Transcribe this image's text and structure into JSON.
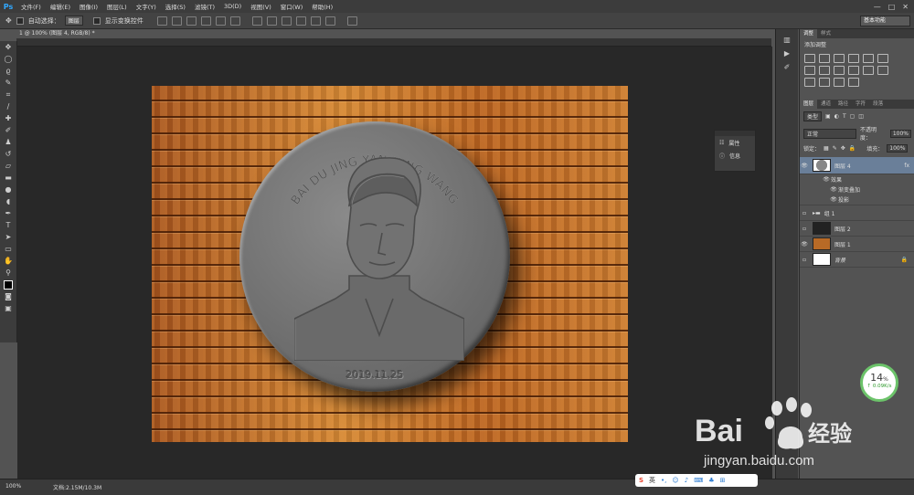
{
  "app": {
    "logo": "Ps"
  },
  "menu": [
    "文件(F)",
    "编辑(E)",
    "图像(I)",
    "图层(L)",
    "文字(Y)",
    "选择(S)",
    "滤镜(T)",
    "3D(D)",
    "视图(V)",
    "窗口(W)",
    "帮助(H)"
  ],
  "options": {
    "auto_select": "自动选择：",
    "auto_select_target": "图层",
    "show_transform": "显示变换控件",
    "workspace": "基本功能"
  },
  "doc_tab": "1 @ 100% (图层 4, RGB/8) *",
  "coin": {
    "top_text": "BAI DU JING YAN XING WANG",
    "date": "2019.11.25"
  },
  "mini_panel": {
    "properties": "属性",
    "info": "信息"
  },
  "adjustments": {
    "tabs": [
      "调整",
      "样式"
    ],
    "title": "添加调整"
  },
  "layers_panel": {
    "tabs": [
      "图层",
      "通道",
      "路径",
      "字符",
      "段落"
    ],
    "filter": "类型",
    "blend_mode": "正常",
    "opacity_label": "不透明度：",
    "opacity": "100%",
    "lock_label": "锁定：",
    "fill_label": "填充：",
    "fill": "100%",
    "layers": [
      {
        "name": "图层 4",
        "fx": "fx"
      },
      {
        "name": "效果"
      },
      {
        "name": "渐变叠加"
      },
      {
        "name": "投影"
      },
      {
        "name": "组 1"
      },
      {
        "name": "图层 2"
      },
      {
        "name": "图层 1"
      },
      {
        "name": "背景"
      }
    ]
  },
  "status": {
    "zoom": "100%",
    "doc": "文档:2.15M/10.3M"
  },
  "net_speed": {
    "percent": "14",
    "unit": "%",
    "speed": "0.09K/s"
  },
  "ime": {
    "lang": "英"
  },
  "watermark": {
    "brand": "Bai",
    "brand_cn": "经验",
    "url": "jingyan.baidu.com"
  },
  "colors": {
    "accent": "#31a8ff",
    "panel": "#535353",
    "dark": "#3c3c3c",
    "wood": "#c97a2f",
    "coin": "#6e6e6e"
  }
}
